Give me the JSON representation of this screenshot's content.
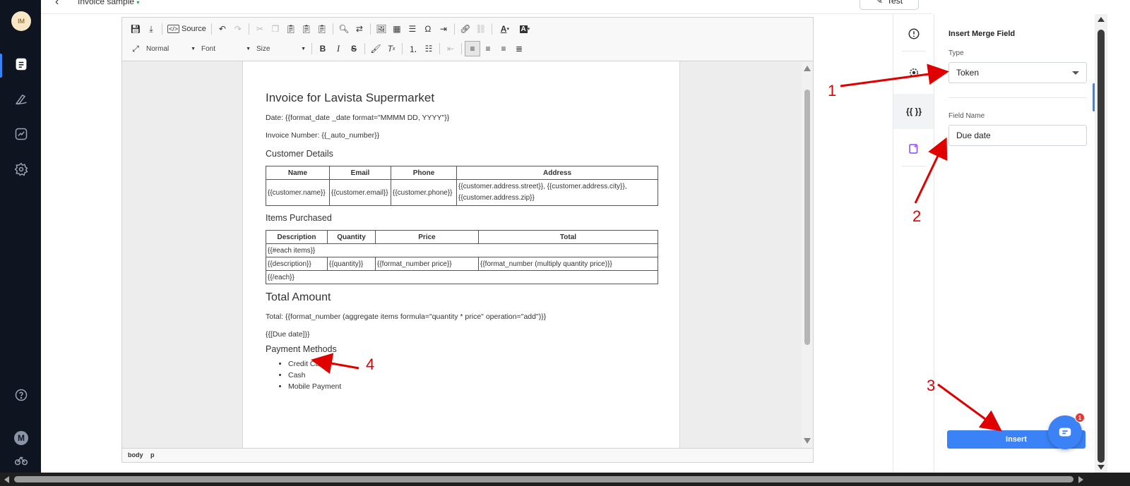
{
  "sidebar": {
    "avatar_initials": "IM",
    "bottom_avatar": "M",
    "items": [
      {
        "name": "documents",
        "icon": "document-icon"
      },
      {
        "name": "signature",
        "icon": "signature-icon"
      },
      {
        "name": "analytics",
        "icon": "chart-icon"
      },
      {
        "name": "settings",
        "icon": "gear-icon"
      },
      {
        "name": "help",
        "icon": "help-icon"
      }
    ]
  },
  "topbar": {
    "doc_title": "Invoice sample",
    "test_label": "Test"
  },
  "toolbar": {
    "source_label": "Source",
    "format_combo": "Normal",
    "font_combo": "Font",
    "size_combo": "Size"
  },
  "document": {
    "title": "Invoice for Lavista Supermarket",
    "date_line": "Date: {{format_date _date format=\"MMMM DD, YYYY\"}}",
    "invoice_number_line": "Invoice Number: {{_auto_number}}",
    "customer_heading": "Customer Details",
    "customer_table": {
      "headers": [
        "Name",
        "Email",
        "Phone",
        "Address"
      ],
      "row": [
        "{{customer.name}}",
        "{{customer.email}}",
        "{{customer.phone}}",
        "{{customer.address.street}}, {{customer.address.city}}, {{customer.address.zip}}"
      ]
    },
    "items_heading": "Items Purchased",
    "items_table": {
      "headers": [
        "Description",
        "Quantity",
        "Price",
        "Total"
      ],
      "each_open": "{{#each items}}",
      "row": [
        "{{description}}",
        "{{quantity}}",
        "{{format_number price}}",
        "{{format_number (multiply quantity price)}}"
      ],
      "each_close": "{{/each}}"
    },
    "total_heading": "Total Amount",
    "total_line": "Total: {{format_number (aggregate items formula=\"quantity * price\" operation=\"add\")}}",
    "due_date_token": "{{[Due date]}}",
    "payment_heading": "Payment Methods",
    "payment_methods": [
      "Credit Card",
      "Cash",
      "Mobile Payment"
    ]
  },
  "statusbar": {
    "path": [
      "body",
      "p"
    ]
  },
  "right_tabs": [
    {
      "name": "info",
      "icon": "alert-circle-icon"
    },
    {
      "name": "preview",
      "icon": "eye-icon"
    },
    {
      "name": "merge-fields",
      "icon": "braces-icon"
    },
    {
      "name": "ai",
      "icon": "sparkle-icon"
    }
  ],
  "panel": {
    "title": "Insert Merge Field",
    "type_label": "Type",
    "type_value": "Token",
    "field_name_label": "Field Name",
    "field_name_value": "Due date",
    "insert_label": "Insert"
  },
  "chat": {
    "badge": "1"
  },
  "annotations": {
    "n1": "1",
    "n2": "2",
    "n3": "3",
    "n4": "4"
  },
  "colors": {
    "accent": "#3b82f6",
    "sidebar_bg": "#0e1521",
    "annotation": "#e00000"
  }
}
